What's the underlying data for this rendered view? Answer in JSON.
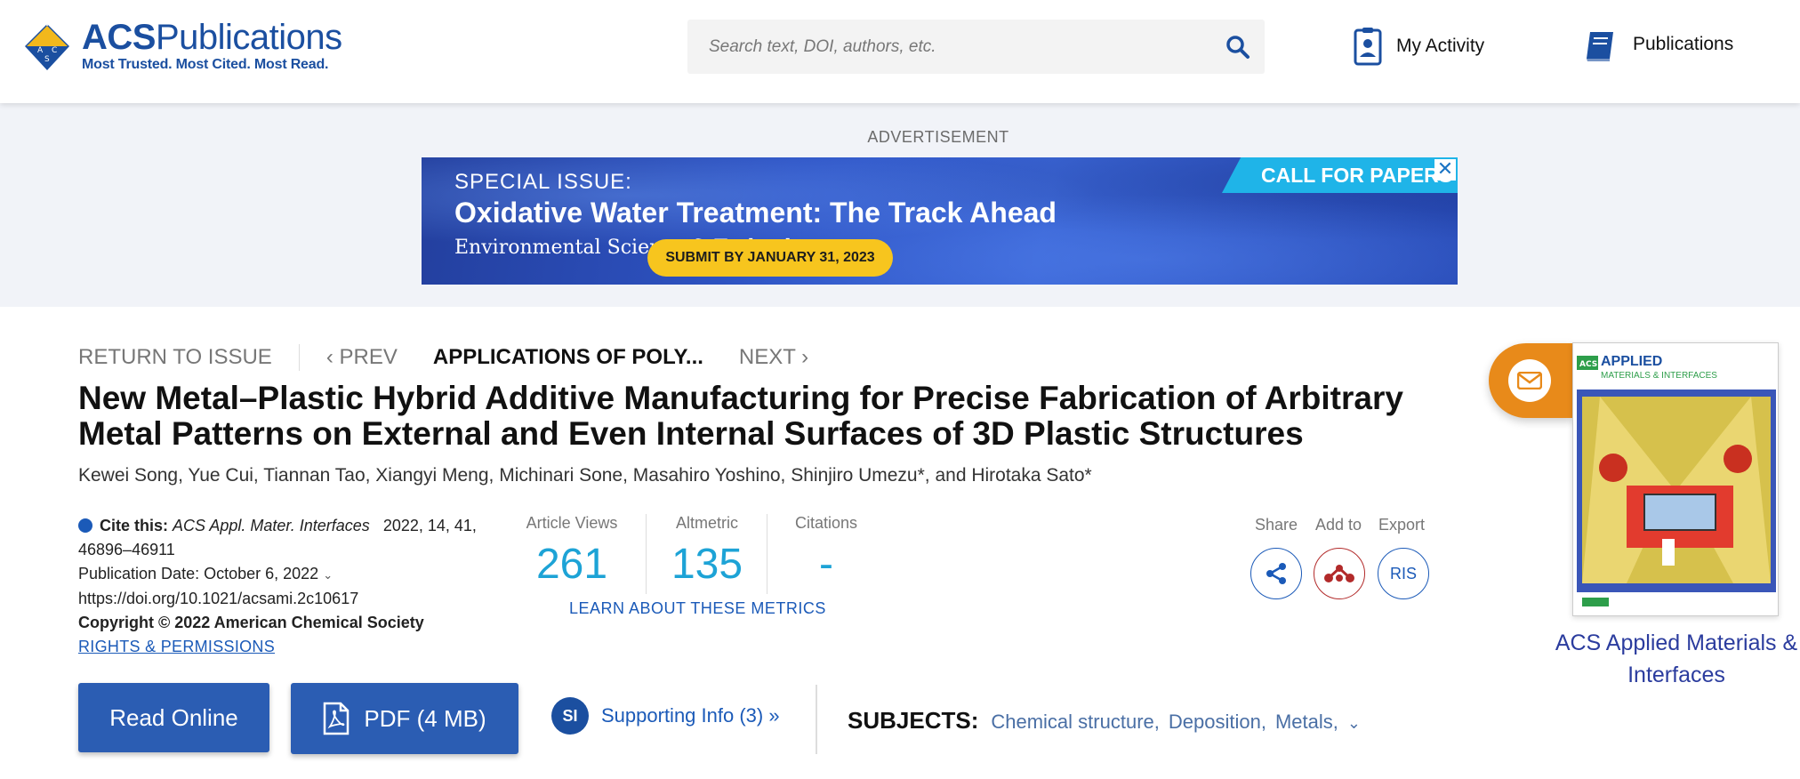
{
  "header": {
    "logo_brand": "ACS",
    "logo_name": "Publications",
    "logo_tagline": "Most Trusted. Most Cited. Most Read.",
    "search_placeholder": "Search text, DOI, authors, etc.",
    "nav": [
      {
        "label": "My Activity",
        "icon": "clipboard-user-icon"
      },
      {
        "label": "Publications",
        "icon": "book-icon"
      }
    ]
  },
  "advertisement": {
    "label": "ADVERTISEMENT",
    "special": "SPECIAL ISSUE:",
    "title": "Oxidative Water Treatment: The Track Ahead",
    "cta_banner": "CALL FOR PAPERS",
    "journal_logo": "Environmental Science & Technology",
    "submit": "SUBMIT BY JANUARY 31, 2023",
    "close_symbol": "✕"
  },
  "article_nav": {
    "return": "RETURN TO ISSUE",
    "prev": "PREV",
    "current": "APPLICATIONS OF POLY...",
    "next": "NEXT"
  },
  "article": {
    "title": "New Metal–Plastic Hybrid Additive Manufacturing for Precise Fabrication of Arbitrary Metal Patterns on External and Even Internal Surfaces of 3D Plastic Structures",
    "authors": "Kewei Song, Yue Cui, Tiannan Tao, Xiangyi Meng, Michinari Sone, Masahiro Yoshino, Shinjiro Umezu*, and Hirotaka Sato*"
  },
  "citation": {
    "cite_label": "Cite this:",
    "journal": "ACS Appl. Mater. Interfaces",
    "volume_info": "2022, 14, 41,",
    "pages": "46896–46911",
    "pub_date": "Publication Date: October 6, 2022",
    "doi": "https://doi.org/10.1021/acsami.2c10617",
    "copyright": "Copyright © 2022 American Chemical Society",
    "rights": "RIGHTS & PERMISSIONS"
  },
  "metrics": {
    "views_label": "Article Views",
    "views": "261",
    "altmetric_label": "Altmetric",
    "altmetric": "135",
    "citations_label": "Citations",
    "citations": "-",
    "learn": "LEARN ABOUT THESE METRICS"
  },
  "tools": {
    "share": "Share",
    "add_to": "Add to",
    "export": "Export",
    "ris": "RIS"
  },
  "actions": {
    "read_online": "Read Online",
    "pdf": "PDF (4 MB)",
    "si_badge": "SI",
    "supporting_info": "Supporting Info (3) »"
  },
  "subjects": {
    "heading": "SUBJECTS:",
    "items": [
      "Chemical structure",
      "Deposition",
      "Metals"
    ]
  },
  "sidebar": {
    "cover_brand": "ACS",
    "cover_title_1": "APPLIED",
    "cover_title_2": "MATERIALS & INTERFACES",
    "journal_name": "ACS Applied Materials & Interfaces"
  },
  "colors": {
    "brand_blue": "#1b4fa0",
    "button_blue": "#2b5db3",
    "metric_blue": "#1da3d6",
    "email_orange": "#e88a1a"
  }
}
